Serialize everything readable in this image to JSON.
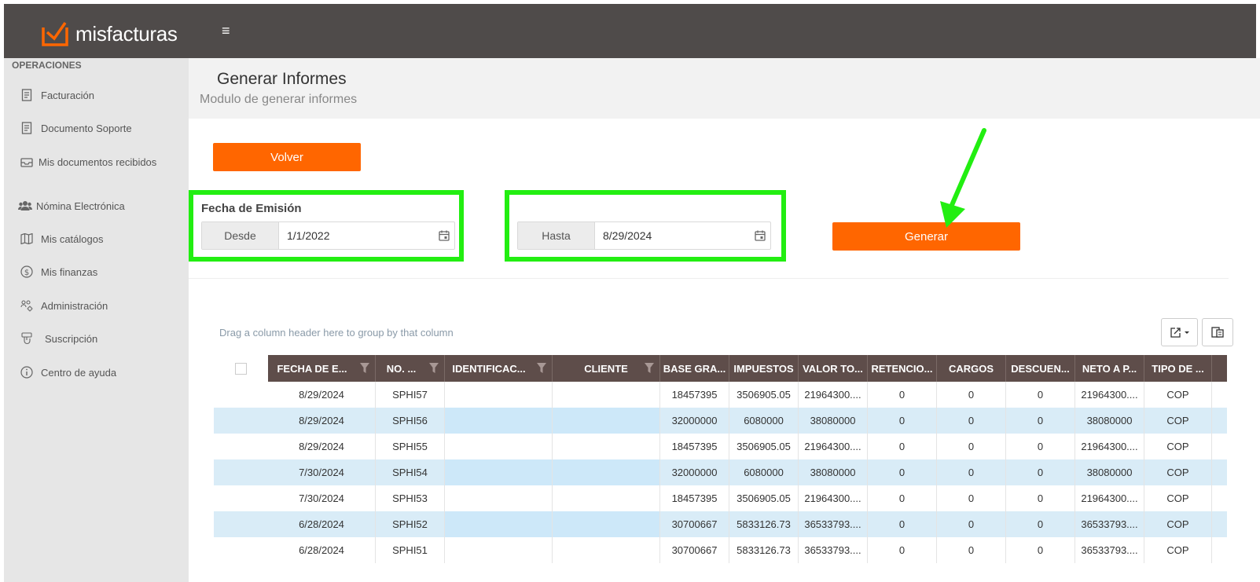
{
  "app": {
    "name": "misfacturas",
    "menu_icon": "hamburger-icon"
  },
  "sidebar": {
    "heading": "OPERACIONES",
    "items": [
      {
        "label": "Facturación",
        "icon": "invoice-icon"
      },
      {
        "label": "Documento Soporte",
        "icon": "document-icon"
      },
      {
        "label": "Mis documentos recibidos",
        "icon": "inbox-icon"
      },
      {
        "label": "Nómina Electrónica",
        "icon": "users-icon"
      },
      {
        "label": "Mis catálogos",
        "icon": "map-icon"
      },
      {
        "label": "Mis finanzas",
        "icon": "dollar-circle-icon"
      },
      {
        "label": "Administración",
        "icon": "admin-icon"
      },
      {
        "label": "Suscripción",
        "icon": "subscription-icon"
      },
      {
        "label": "Centro de ayuda",
        "icon": "info-circle-icon"
      }
    ]
  },
  "header": {
    "title": "Generar Informes",
    "subtitle": "Modulo de generar informes"
  },
  "actions": {
    "back_label": "Volver",
    "generate_label": "Generar"
  },
  "filters": {
    "section_label": "Fecha de Emisión",
    "from_label": "Desde",
    "from_value": "1/1/2022",
    "to_label": "Hasta",
    "to_value": "8/29/2024"
  },
  "colors": {
    "accent": "#ff6600",
    "topbar": "#4f4b4a",
    "grid_header": "#5e4d4a",
    "highlight": "#22ee11",
    "row_alt": "#d9ecf7"
  },
  "grid": {
    "group_hint": "Drag a column header here to group by that column",
    "columns": [
      "FECHA DE E...",
      "NO. ...",
      "IDENTIFICAC...",
      "CLIENTE",
      "BASE GRA...",
      "IMPUESTOS",
      "VALOR TO...",
      "RETENCIO...",
      "CARGOS",
      "DESCUEN...",
      "NETO A P...",
      "TIPO DE ..."
    ],
    "rows": [
      [
        "8/29/2024",
        "SPHI57",
        "",
        "",
        "18457395",
        "3506905.05",
        "21964300....",
        "0",
        "0",
        "0",
        "21964300....",
        "COP"
      ],
      [
        "8/29/2024",
        "SPHI56",
        "",
        "",
        "32000000",
        "6080000",
        "38080000",
        "0",
        "0",
        "0",
        "38080000",
        "COP"
      ],
      [
        "8/29/2024",
        "SPHI55",
        "",
        "",
        "18457395",
        "3506905.05",
        "21964300....",
        "0",
        "0",
        "0",
        "21964300....",
        "COP"
      ],
      [
        "7/30/2024",
        "SPHI54",
        "",
        "",
        "32000000",
        "6080000",
        "38080000",
        "0",
        "0",
        "0",
        "38080000",
        "COP"
      ],
      [
        "7/30/2024",
        "SPHI53",
        "",
        "",
        "18457395",
        "3506905.05",
        "21964300....",
        "0",
        "0",
        "0",
        "21964300....",
        "COP"
      ],
      [
        "6/28/2024",
        "SPHI52",
        "",
        "",
        "30700667",
        "5833126.73",
        "36533793....",
        "0",
        "0",
        "0",
        "36533793....",
        "COP"
      ],
      [
        "6/28/2024",
        "SPHI51",
        "",
        "",
        "30700667",
        "5833126.73",
        "36533793....",
        "0",
        "0",
        "0",
        "36533793....",
        "COP"
      ]
    ]
  }
}
